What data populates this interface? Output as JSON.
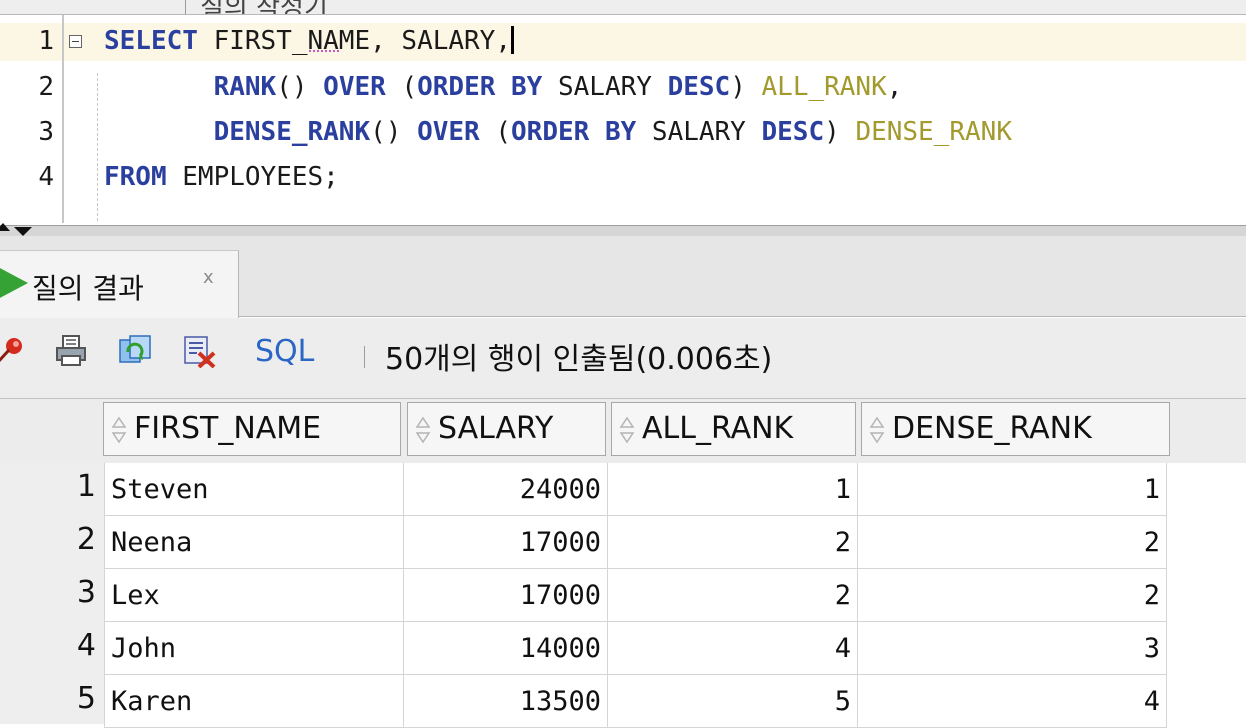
{
  "top_tab": {
    "label": "질의 작성기"
  },
  "editor": {
    "lines": [
      {
        "number": "1",
        "tokens": [
          {
            "t": "SELECT",
            "k": "kw"
          },
          {
            "t": " FIRST_NAME, SALARY,",
            "k": ""
          }
        ]
      },
      {
        "number": "2",
        "tokens": [
          {
            "t": "       ",
            "k": ""
          },
          {
            "t": "RANK",
            "k": "kw"
          },
          {
            "t": "() ",
            "k": ""
          },
          {
            "t": "OVER",
            "k": "kw"
          },
          {
            "t": " (",
            "k": ""
          },
          {
            "t": "ORDER BY",
            "k": "kw"
          },
          {
            "t": " SALARY ",
            "k": ""
          },
          {
            "t": "DESC",
            "k": "kw"
          },
          {
            "t": ") ",
            "k": ""
          },
          {
            "t": "ALL_RANK",
            "k": "alias"
          },
          {
            "t": ",",
            "k": ""
          }
        ]
      },
      {
        "number": "3",
        "tokens": [
          {
            "t": "       ",
            "k": ""
          },
          {
            "t": "DENSE_RANK",
            "k": "kw"
          },
          {
            "t": "() ",
            "k": ""
          },
          {
            "t": "OVER",
            "k": "kw"
          },
          {
            "t": " (",
            "k": ""
          },
          {
            "t": "ORDER BY",
            "k": "kw"
          },
          {
            "t": " SALARY ",
            "k": ""
          },
          {
            "t": "DESC",
            "k": "kw"
          },
          {
            "t": ") ",
            "k": ""
          },
          {
            "t": "DENSE_RANK",
            "k": "alias"
          }
        ]
      },
      {
        "number": "4",
        "tokens": [
          {
            "t": "FROM",
            "k": "kw"
          },
          {
            "t": " EMPLOYEES;",
            "k": ""
          }
        ]
      }
    ]
  },
  "results_tab": {
    "label": "질의 결과",
    "close": "x"
  },
  "toolbar": {
    "sql_label": "SQL",
    "status": "50개의 행이 인출됨(0.006초)"
  },
  "grid": {
    "columns": [
      "FIRST_NAME",
      "SALARY",
      "ALL_RANK",
      "DENSE_RANK"
    ],
    "rows": [
      {
        "n": "1",
        "first_name": "Steven",
        "salary": "24000",
        "all_rank": "1",
        "dense_rank": "1"
      },
      {
        "n": "2",
        "first_name": "Neena",
        "salary": "17000",
        "all_rank": "2",
        "dense_rank": "2"
      },
      {
        "n": "3",
        "first_name": "Lex",
        "salary": "17000",
        "all_rank": "2",
        "dense_rank": "2"
      },
      {
        "n": "4",
        "first_name": "John",
        "salary": "14000",
        "all_rank": "4",
        "dense_rank": "3"
      },
      {
        "n": "5",
        "first_name": "Karen",
        "salary": "13500",
        "all_rank": "5",
        "dense_rank": "4"
      }
    ]
  },
  "colors": {
    "keyword": "#2b3f9e",
    "alias": "#a39a2e",
    "current_line": "#fcf6e4",
    "sql_link": "#2a66c5",
    "run_icon": "#34a234"
  },
  "icons": [
    "fold-collapse-icon",
    "run-icon",
    "pin-icon",
    "print-icon",
    "refresh-icon",
    "export-icon",
    "sort-icon"
  ]
}
